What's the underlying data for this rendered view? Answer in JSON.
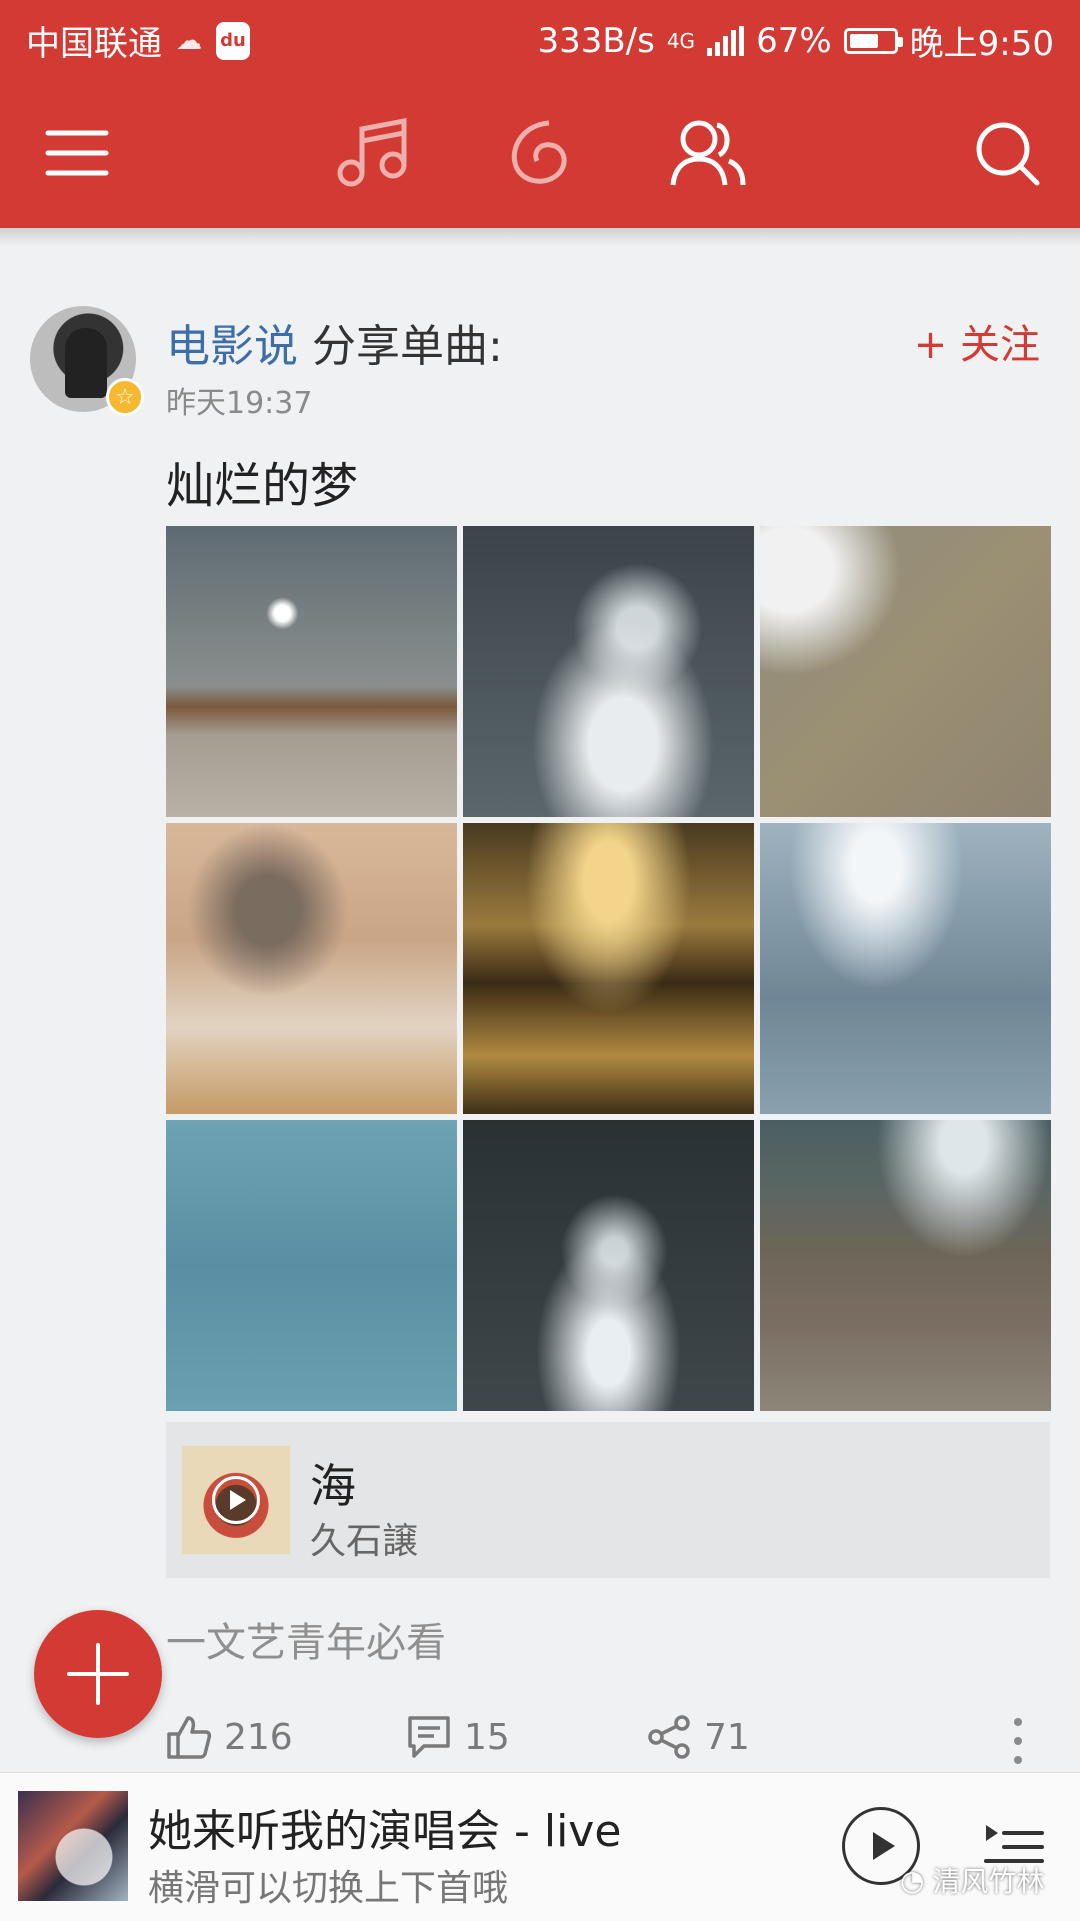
{
  "status_bar": {
    "carrier": "中国联通",
    "network_speed": "333B/s",
    "network_type": "4G",
    "battery_percent": "67%",
    "battery_level": 0.67,
    "time": "晚上9:50",
    "du_badge": "du"
  },
  "header": {
    "accent_color": "#d33a33",
    "icons": [
      "menu-icon",
      "music-note-icon",
      "netease-icon",
      "friends-icon",
      "search-icon"
    ]
  },
  "post": {
    "author": "电影说",
    "action": "分享单曲:",
    "follow_label": "+ 关注",
    "time": "昨天19:37",
    "title": "灿烂的梦",
    "song": {
      "name": "海",
      "artist": "久石譲"
    },
    "tagline": "一文艺青年必看",
    "likes": "216",
    "comments": "15",
    "shares": "71"
  },
  "player": {
    "title": "她来听我的演唱会 - live",
    "subtitle": "横滑可以切换上下首哦",
    "watermark": "清风竹林"
  }
}
